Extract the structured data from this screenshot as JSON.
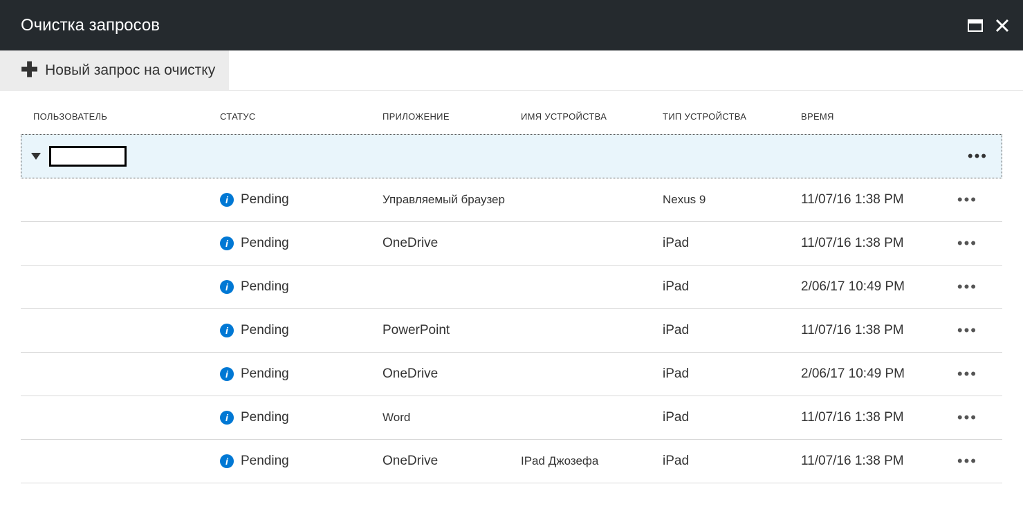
{
  "header": {
    "title": "Очистка запросов"
  },
  "toolbar": {
    "new_request": "Новый запрос на очистку"
  },
  "columns": {
    "user": "ПОЛЬЗОВАТЕЛЬ",
    "status": "СТАТУС",
    "app": "ПРИЛОЖЕНИЕ",
    "device_name": "ИМЯ УСТРОЙСТВА",
    "device_type": "ТИП УСТРОЙСТВА",
    "time": "ВРЕМЯ"
  },
  "rows": [
    {
      "status": "Pending",
      "app": "Управляемый браузер",
      "device_name": "",
      "device_type": "Nexus 9",
      "time": "11/07/16 1:38 PM"
    },
    {
      "status": "Pending",
      "app": "OneDrive",
      "device_name": "",
      "device_type": "iPad",
      "time": "11/07/16 1:38 PM"
    },
    {
      "status": "Pending",
      "app": "",
      "device_name": "",
      "device_type": "iPad",
      "time": "2/06/17 10:49 PM"
    },
    {
      "status": "Pending",
      "app": "PowerPoint",
      "device_name": "",
      "device_type": "iPad",
      "time": "11/07/16 1:38 PM"
    },
    {
      "status": "Pending",
      "app": "OneDrive",
      "device_name": "",
      "device_type": "iPad",
      "time": "2/06/17 10:49 PM"
    },
    {
      "status": "Pending",
      "app": "Word",
      "device_name": "",
      "device_type": "iPad",
      "time": "11/07/16 1:38 PM"
    },
    {
      "status": "Pending",
      "app": "OneDrive",
      "device_name": "IPad Джозефа",
      "device_type": "iPad",
      "time": "11/07/16 1:38 PM"
    }
  ]
}
